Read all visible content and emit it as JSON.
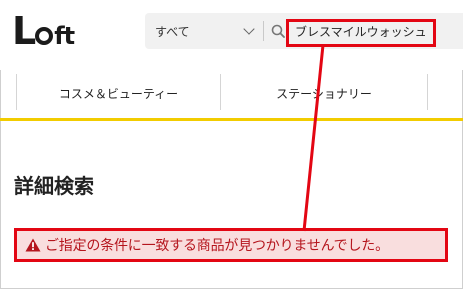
{
  "header": {
    "logo_text": "Loft",
    "category_select": {
      "value": "すべて"
    },
    "search": {
      "value": "ブレスマイルウォッシュ"
    }
  },
  "nav": {
    "items": [
      {
        "label": "コスメ＆ビューティー"
      },
      {
        "label": "ステーショナリー"
      }
    ]
  },
  "main": {
    "page_title": "詳細検索",
    "error_message": "ご指定の条件に一致する商品が見つかりませんでした。"
  },
  "colors": {
    "accent_yellow": "#f2cc00",
    "highlight_red": "#e30613",
    "error_bg": "#f9dede",
    "error_text": "#b5161e"
  },
  "icons": [
    "search-icon",
    "chevron-down-icon",
    "warning-icon"
  ]
}
